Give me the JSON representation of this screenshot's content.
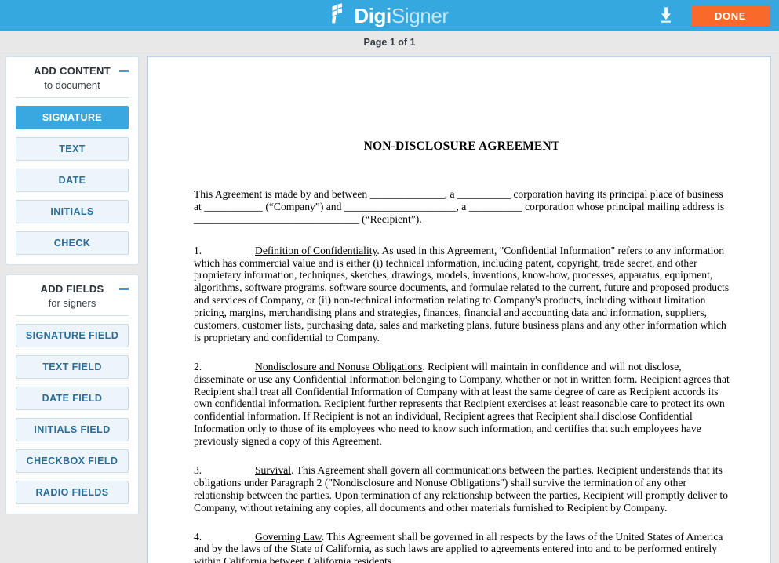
{
  "header": {
    "logo_primary": "Digi",
    "logo_secondary": "Signer",
    "logo_mark_icon": "checkered-flag-icon",
    "download_icon": "download-icon",
    "download_label": "Download",
    "done_label": "DONE",
    "background_color": "#35a8e0",
    "done_color": "#f9692a"
  },
  "page_bar": {
    "label": "Page 1 of 1"
  },
  "sidebar": {
    "panels": [
      {
        "title": "ADD CONTENT",
        "subtitle": "to document",
        "collapse_icon": "minus-icon",
        "buttons": [
          {
            "label": "SIGNATURE",
            "active": true
          },
          {
            "label": "TEXT",
            "active": false
          },
          {
            "label": "DATE",
            "active": false
          },
          {
            "label": "INITIALS",
            "active": false
          },
          {
            "label": "CHECK",
            "active": false
          }
        ]
      },
      {
        "title": "ADD FIELDS",
        "subtitle": "for signers",
        "collapse_icon": "minus-icon",
        "buttons": [
          {
            "label": "SIGNATURE FIELD",
            "active": false
          },
          {
            "label": "TEXT FIELD",
            "active": false
          },
          {
            "label": "DATE FIELD",
            "active": false
          },
          {
            "label": "INITIALS FIELD",
            "active": false
          },
          {
            "label": "CHECKBOX FIELD",
            "active": false
          },
          {
            "label": "RADIO FIELDS",
            "active": false
          }
        ]
      }
    ],
    "accent_color": "#3aa8e0",
    "button_text_color": "#2a6d99"
  },
  "document": {
    "title": "NON-DISCLOSURE AGREEMENT",
    "intro": "This Agreement is made by and between ______________, a __________ corporation having its principal place of business at ___________ (“Company”) and _____________________, a __________ corporation whose principal mailing address is _______________________________ (“Recipient”).",
    "sections": [
      {
        "number": "1.",
        "heading": "Definition of Confidentiality",
        "body": ". As used in this Agreement, \"Confidential Information\" refers to any information which has commercial value and is either (i) technical information, including patent, copyright, trade secret, and other proprietary information, techniques, sketches, drawings, models, inventions, know-how, processes, apparatus, equipment, algorithms, software programs, software source documents, and formulae related to the current, future and proposed products and services of Company, or (ii) non-technical information relating to Company's products, including without limitation pricing, margins, merchandising plans and strategies, finances, financial and accounting data and information, suppliers, customers, customer lists, purchasing data, sales and marketing plans, future business plans and any other information which is proprietary and confidential to Company."
      },
      {
        "number": "2.",
        "heading": "Nondisclosure and Nonuse Obligations",
        "body": ". Recipient will maintain in confidence and will not disclose, disseminate or use any Confidential Information belonging to Company, whether or not in written form.  Recipient agrees that Recipient shall treat all Confidential Information of Company with at least the same degree of care as Recipient accords its own confidential information.  Recipient further represents that Recipient exercises at least reasonable care to protect its own confidential information.  If Recipient is not an individual, Recipient agrees that Recipient shall disclose Confidential Information only to those of its employees who need to know such information, and certifies that such employees have previously signed a copy of this Agreement."
      },
      {
        "number": "3.",
        "heading": "Survival",
        "body": ".  This Agreement shall govern all communications between the parties.  Recipient understands that its obligations under Paragraph 2 (\"Nondisclosure and Nonuse Obligations\") shall survive the termination of any other relationship between the parties.  Upon termination of any relationship between the parties, Recipient will promptly deliver to Company, without retaining any copies, all documents and other materials furnished to Recipient by Company."
      },
      {
        "number": "4.",
        "heading": "Governing Law",
        "body": ".  This Agreement shall be governed in all respects by the laws of the United States of America and by the laws of the State of California, as such laws are applied to agreements entered into and to be performed entirely within California between California residents."
      }
    ]
  }
}
